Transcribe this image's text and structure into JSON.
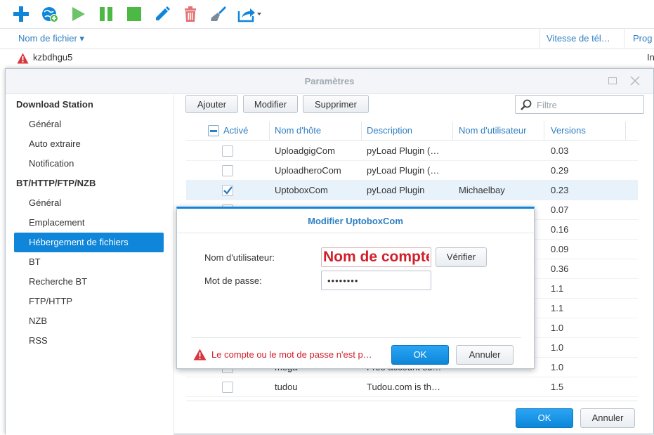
{
  "colors": {
    "accent": "#0f86d9",
    "link": "#2f7fc1",
    "error": "#d11f2a",
    "success": "#4cb944"
  },
  "toolbar": {
    "buttons": [
      {
        "icon": "plus-icon"
      },
      {
        "icon": "globe-add-icon"
      },
      {
        "icon": "play-icon"
      },
      {
        "icon": "pause-icon"
      },
      {
        "icon": "stop-icon"
      },
      {
        "icon": "pencil-icon"
      },
      {
        "icon": "trash-icon"
      },
      {
        "icon": "broom-icon"
      },
      {
        "icon": "share-dropdown-icon"
      }
    ]
  },
  "task_list": {
    "columns": [
      "Nom de fichier ▾",
      "Vitesse de tél…",
      "Prog"
    ],
    "rows": [
      {
        "name": "kzbdhgu5",
        "truncated": "In"
      }
    ]
  },
  "settings": {
    "title": "Paramètres",
    "sidebar": {
      "groups": [
        {
          "label": "Download Station",
          "items": [
            "Général",
            "Auto extraire",
            "Notification"
          ]
        },
        {
          "label": "BT/HTTP/FTP/NZB",
          "items": [
            "Général",
            "Emplacement",
            "Hébergement de fichiers",
            "BT",
            "Recherche BT",
            "FTP/HTTP",
            "NZB",
            "RSS"
          ]
        }
      ],
      "active": "Hébergement de fichiers"
    },
    "buttons": {
      "add": "Ajouter",
      "edit": "Modifier",
      "delete": "Supprimer",
      "ok": "OK",
      "cancel": "Annuler"
    },
    "filter_placeholder": "Filtre",
    "grid": {
      "columns": [
        "Activé",
        "Nom d'hôte",
        "Description",
        "Nom d'utilisateur",
        "Versions"
      ],
      "rows": [
        {
          "checked": false,
          "host": "UploadgigCom",
          "description": "pyLoad Plugin (…",
          "user": "",
          "version": "0.03"
        },
        {
          "checked": false,
          "host": "UploadheroCom",
          "description": "pyLoad Plugin (…",
          "user": "",
          "version": "0.29"
        },
        {
          "checked": true,
          "host": "UptoboxCom",
          "description": "pyLoad Plugin",
          "user": "Michaelbay",
          "version": "0.23"
        },
        {
          "checked": false,
          "host": "",
          "description": "",
          "user": "",
          "version": "0.07"
        },
        {
          "checked": false,
          "host": "",
          "description": "",
          "user": "",
          "version": "0.16"
        },
        {
          "checked": false,
          "host": "",
          "description": "",
          "user": "",
          "version": "0.09"
        },
        {
          "checked": false,
          "host": "",
          "description": "",
          "user": "",
          "version": "0.36"
        },
        {
          "checked": false,
          "host": "",
          "description": "",
          "user": "",
          "version": "1.1"
        },
        {
          "checked": false,
          "host": "",
          "description": "",
          "user": "",
          "version": "1.1"
        },
        {
          "checked": false,
          "host": "",
          "description": "",
          "user": "",
          "version": "1.0"
        },
        {
          "checked": false,
          "host": "",
          "description": "",
          "user": "",
          "version": "1.0"
        },
        {
          "checked": false,
          "host": "mega",
          "description": "Free account su…",
          "user": "",
          "version": "1.0"
        },
        {
          "checked": false,
          "host": "tudou",
          "description": "Tudou.com is th…",
          "user": "",
          "version": "1.5"
        }
      ]
    }
  },
  "dialog": {
    "title": "Modifier UptoboxCom",
    "username_label": "Nom d'utilisateur:",
    "username_value": "Nom de compte",
    "verify_label": "Vérifier",
    "password_label": "Mot de passe:",
    "password_value": "••••••••",
    "error_message": "Le compte ou le mot de passe n'est p…",
    "ok_label": "OK",
    "cancel_label": "Annuler"
  }
}
